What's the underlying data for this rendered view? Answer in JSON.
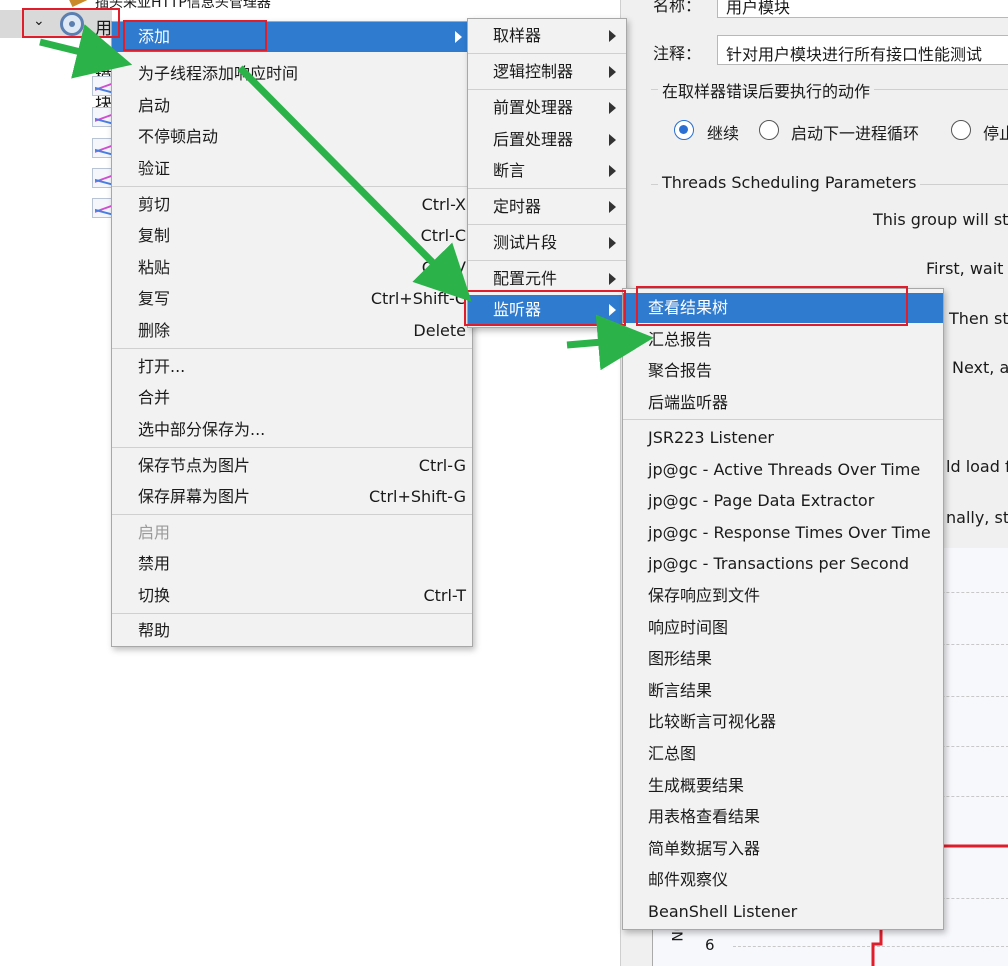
{
  "tree": {
    "top_label": "插头采亚HTTP信息头管理器",
    "selected_label": "用户模块"
  },
  "panel": {
    "name_label": "名称：",
    "name_value": "用户模块",
    "comment_label": "注释：",
    "comment_value": "针对用户模块进行所有接口性能测试",
    "error_group_title": "在取样器错误后要执行的动作",
    "radio_continue": "继续",
    "radio_next_loop": "启动下一进程循环",
    "radio_stop": "停止",
    "threads_title": "Threads Scheduling Parameters",
    "line1": "This group will sta",
    "line2": "First, wait f",
    "line3": "Then sta",
    "line4": "Next, ac",
    "line5": "ld load f",
    "line6": "nally, sto",
    "chart_axis_label": "Nu",
    "chart_tick": "6"
  },
  "menu1": {
    "add": "添加",
    "add_response_time": "为子线程添加响应时间",
    "start": "启动",
    "start_no_pause": "不停顿启动",
    "validate": "验证",
    "cut": "剪切",
    "cut_key": "Ctrl-X",
    "copy": "复制",
    "copy_key": "Ctrl-C",
    "paste": "粘贴",
    "paste_key": "Ctrl-V",
    "duplicate": "复写",
    "duplicate_key": "Ctrl+Shift-C",
    "delete": "删除",
    "delete_key": "Delete",
    "open": "打开...",
    "merge": "合并",
    "save_selection": "选中部分保存为...",
    "save_node_image": "保存节点为图片",
    "save_node_image_key": "Ctrl-G",
    "save_screen_image": "保存屏幕为图片",
    "save_screen_image_key": "Ctrl+Shift-G",
    "enable": "启用",
    "disable": "禁用",
    "toggle": "切换",
    "toggle_key": "Ctrl-T",
    "help": "帮助"
  },
  "menu2": {
    "sampler": "取样器",
    "logic_controller": "逻辑控制器",
    "pre_processor": "前置处理器",
    "post_processor": "后置处理器",
    "assertion": "断言",
    "timer": "定时器",
    "test_fragment": "测试片段",
    "config_element": "配置元件",
    "listener": "监听器"
  },
  "menu3": {
    "items_a": [
      "查看结果树",
      "汇总报告",
      "聚合报告",
      "后端监听器"
    ],
    "items_b": [
      "JSR223 Listener",
      "jp@gc - Active Threads Over Time",
      "jp@gc - Page Data Extractor",
      "jp@gc - Response Times Over Time",
      "jp@gc - Transactions per Second",
      "保存响应到文件",
      "响应时间图",
      "图形结果",
      "断言结果",
      "比较断言可视化器",
      "汇总图",
      "生成概要结果",
      "用表格查看结果",
      "简单数据写入器",
      "邮件观察仪",
      "BeanShell Listener"
    ]
  },
  "colors": {
    "highlight": "#2f7bcf",
    "annotation_red": "#e01d2b",
    "annotation_green": "#2bb34a"
  }
}
